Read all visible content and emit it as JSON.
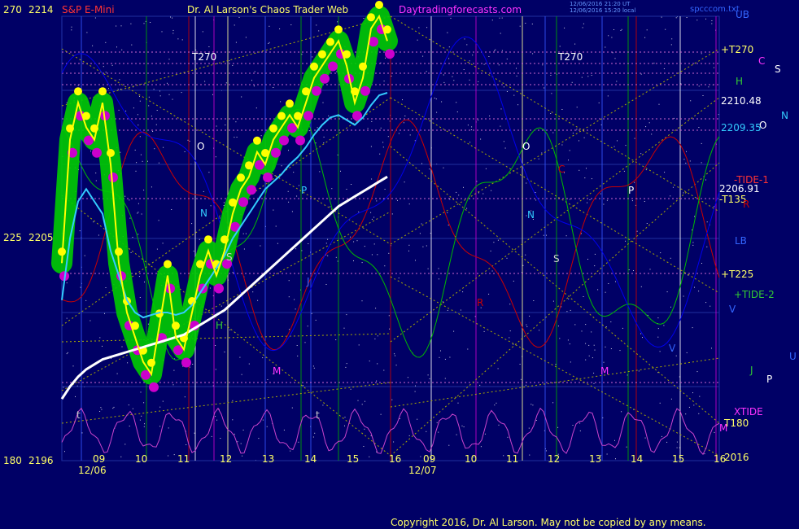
{
  "header": {
    "symbol": "S&P E-Mini",
    "title": "Dr. Al Larson's Chaos Trader Web",
    "site": "Daytradingforecasts.com",
    "timestamp_line1": "12/06/2016 21:20 UT",
    "timestamp_line2": "12/06/2016 15:20 local",
    "corner_code": "spcccom.txt"
  },
  "footer": {
    "copyright": "Copyright 2016, Dr. Al Larson. May not be copied by any means."
  },
  "colors": {
    "background": "#000066",
    "price_bars": "#ffff00",
    "green_glow": "#00cc00",
    "magenta_dots": "#cc00cc",
    "white_ma": "#ffffff",
    "cyan_ma": "#33ccff",
    "tide1": "#cc0000",
    "tide2": "#00bb00",
    "blue_line": "#0000ee",
    "xtide": "#cc44cc",
    "yellow_dotted": "#aaaa00"
  },
  "chart_data": {
    "type": "line",
    "title": "S&P E-Mini",
    "xlabel": "",
    "ylabel": "",
    "ylim": [
      2196,
      2214
    ],
    "y_ticks": [
      {
        "angle": "270",
        "price": "2214"
      },
      {
        "angle": "225",
        "price": "2205"
      },
      {
        "angle": "180",
        "price": "2196"
      }
    ],
    "dates": [
      "12/06",
      "12/07"
    ],
    "hour_ticks_day1": [
      "09",
      "10",
      "11",
      "12",
      "13",
      "14",
      "15",
      "16"
    ],
    "hour_ticks_day2": [
      "09",
      "10",
      "11",
      "12",
      "13",
      "14",
      "15",
      "16"
    ],
    "year_label": "2016",
    "right_labels": [
      {
        "text": "UB",
        "color": "#3366ff"
      },
      {
        "text": "+T270",
        "color": "#ffff66"
      },
      {
        "text": "C",
        "color": "#ff33ff"
      },
      {
        "text": "S",
        "color": "#ffffff"
      },
      {
        "text": "H",
        "color": "#33cc33"
      },
      {
        "text": "2210.48",
        "color": "#ffffff"
      },
      {
        "text": "N",
        "color": "#33ccff"
      },
      {
        "text": "2209.35",
        "color": "#33ccff"
      },
      {
        "text": "O",
        "color": "#ffffff"
      },
      {
        "text": "-TIDE-1",
        "color": "#ff3333"
      },
      {
        "text": "2206.91",
        "color": "#ffffff"
      },
      {
        "text": "-T135",
        "color": "#ffff66"
      },
      {
        "text": "R",
        "color": "#cc0000"
      },
      {
        "text": "LB",
        "color": "#3366ff"
      },
      {
        "text": "+T225",
        "color": "#ffff66"
      },
      {
        "text": "+TIDE-2",
        "color": "#33cc33"
      },
      {
        "text": "V",
        "color": "#3366ff"
      },
      {
        "text": "U",
        "color": "#3366ff"
      },
      {
        "text": "J",
        "color": "#33cc33"
      },
      {
        "text": "P",
        "color": "#ffffff"
      },
      {
        "text": "XTIDE",
        "color": "#ff33ff"
      },
      {
        "text": "M",
        "color": "#ff33ff"
      },
      {
        "text": "T180",
        "color": "#ffff66"
      }
    ],
    "chart_labels": [
      {
        "text": "T270",
        "color": "#ffffff"
      },
      {
        "text": "T270",
        "color": "#ffffff"
      },
      {
        "text": "O",
        "color": "#ffffff"
      },
      {
        "text": "O",
        "color": "#ffffff"
      },
      {
        "text": "N",
        "color": "#33ccff"
      },
      {
        "text": "N",
        "color": "#33ccff"
      },
      {
        "text": "P",
        "color": "#33ccff"
      },
      {
        "text": "P",
        "color": "#ffffff"
      },
      {
        "text": "S",
        "color": "#cccccc"
      },
      {
        "text": "S",
        "color": "#cccccc"
      },
      {
        "text": "H",
        "color": "#33cc33"
      },
      {
        "text": "J",
        "color": "#3366ff"
      },
      {
        "text": "M",
        "color": "#ff33ff"
      },
      {
        "text": "M",
        "color": "#ff33ff"
      },
      {
        "text": "C",
        "color": "#cc0000"
      },
      {
        "text": "R",
        "color": "#cc0000"
      },
      {
        "text": "V",
        "color": "#3366ff"
      },
      {
        "text": "t",
        "color": "#cccccc"
      },
      {
        "text": "t",
        "color": "#cccccc"
      }
    ],
    "series": [
      {
        "name": "price",
        "values": [
          2204.0,
          2209.0,
          2210.5,
          2209.5,
          2209.0,
          2210.5,
          2208.0,
          2204.0,
          2202.0,
          2201.0,
          2200.0,
          2199.5,
          2201.5,
          2203.5,
          2201.0,
          2200.5,
          2202.0,
          2203.5,
          2204.5,
          2203.5,
          2204.5,
          2206.0,
          2207.0,
          2207.5,
          2208.5,
          2208.0,
          2209.0,
          2209.5,
          2210.0,
          2209.5,
          2210.5,
          2211.5,
          2212.0,
          2212.5,
          2213.0,
          2212.0,
          2210.5,
          2211.5,
          2213.5,
          2214.0,
          2213.0
        ]
      },
      {
        "name": "short ma",
        "values": [
          2202.5,
          2205.0,
          2206.5,
          2207.0,
          2206.5,
          2206.0,
          2204.5,
          2203.5,
          2202.5,
          2202.0,
          2201.8,
          2201.9,
          2202.0,
          2202.0,
          2201.9,
          2202.0,
          2202.3,
          2202.8,
          2203.3,
          2203.8,
          2204.3,
          2205.0,
          2205.5,
          2206.0,
          2206.5,
          2207.0,
          2207.3,
          2207.6,
          2208.0,
          2208.3,
          2208.7,
          2209.2,
          2209.6,
          2209.9,
          2210.0,
          2209.8,
          2209.6,
          2209.9,
          2210.4,
          2210.8,
          2210.9
        ]
      },
      {
        "name": "long ma",
        "values": [
          2198.5,
          2199.0,
          2199.4,
          2199.7,
          2199.9,
          2200.1,
          2200.2,
          2200.3,
          2200.4,
          2200.5,
          2200.6,
          2200.7,
          2200.8,
          2200.9,
          2201.0,
          2201.1,
          2201.3,
          2201.5,
          2201.7,
          2201.9,
          2202.1,
          2202.4,
          2202.7,
          2203.0,
          2203.3,
          2203.6,
          2203.9,
          2204.2,
          2204.5,
          2204.8,
          2205.1,
          2205.4,
          2205.7,
          2206.0,
          2206.3,
          2206.5,
          2206.7,
          2206.9,
          2207.1,
          2207.3,
          2207.5
        ]
      }
    ]
  }
}
